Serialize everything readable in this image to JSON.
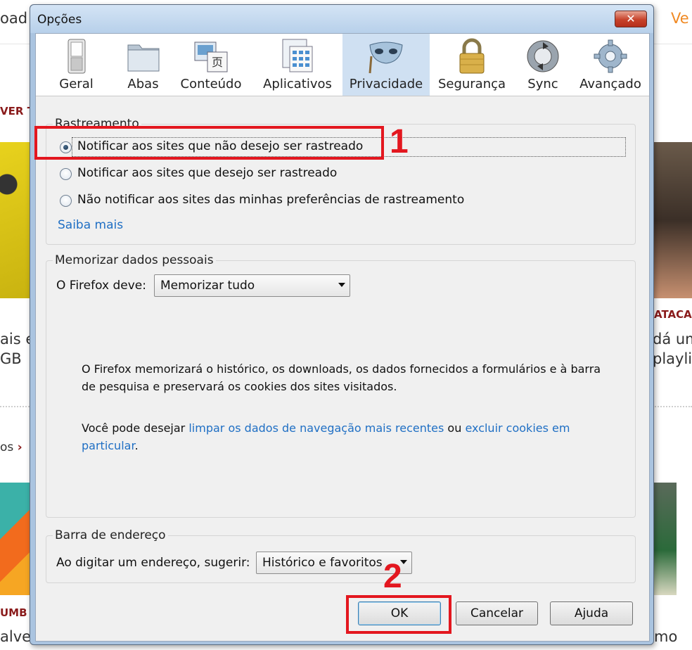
{
  "background": {
    "top_left_text": "oad",
    "top_right_text": "Ve",
    "left_red_text": "VER T",
    "left_text_1": "ais e",
    "left_text_2": "GB",
    "left_link": "os",
    "left_chevron": "›",
    "left_red_bottom": "UMB V",
    "left_bottom_text": "alve",
    "right_red_text": "ATACA",
    "right_text_1": "dá um",
    "right_text_2": "playlis",
    "right_bottom_text": "mo"
  },
  "dialog": {
    "title": "Opções",
    "close_symbol": "✕",
    "panes": [
      {
        "label": "Geral",
        "icon": "switch-icon"
      },
      {
        "label": "Abas",
        "icon": "folder-tabs-icon"
      },
      {
        "label": "Conteúdo",
        "icon": "content-icon"
      },
      {
        "label": "Aplicativos",
        "icon": "applications-icon"
      },
      {
        "label": "Privacidade",
        "icon": "mask-icon",
        "selected": true
      },
      {
        "label": "Segurança",
        "icon": "padlock-icon"
      },
      {
        "label": "Sync",
        "icon": "sync-icon"
      },
      {
        "label": "Avançado",
        "icon": "gear-icon"
      }
    ],
    "tracking": {
      "title": "Rastreamento",
      "options": [
        {
          "label": "Notificar aos sites que não desejo ser rastreado",
          "checked": true
        },
        {
          "label": "Notificar aos sites que desejo ser rastreado",
          "checked": false
        },
        {
          "label": "Não notificar aos sites das minhas preferências de rastreamento",
          "checked": false
        }
      ],
      "learn_more": "Saiba mais"
    },
    "history": {
      "title": "Memorizar dados pessoais",
      "label": "O Firefox deve:",
      "selected": "Memorizar tudo",
      "desc_1": "O Firefox memorizará o histórico, os downloads, os dados fornecidos a formulários e à barra de pesquisa e preservará os cookies dos sites visitados.",
      "desc_2_prefix": "Você pode desejar ",
      "desc_2_link1": "limpar os dados de navegação mais recentes",
      "desc_2_middle": " ou ",
      "desc_2_link2": "excluir cookies em particular",
      "desc_2_suffix": "."
    },
    "location_bar": {
      "title": "Barra de endereço",
      "label": "Ao digitar um endereço, sugerir:",
      "selected": "Histórico e favoritos"
    },
    "buttons": {
      "ok": "OK",
      "cancel": "Cancelar",
      "help": "Ajuda"
    }
  },
  "annotations": {
    "step1": "1",
    "step2": "2",
    "color": "#e3171f"
  }
}
